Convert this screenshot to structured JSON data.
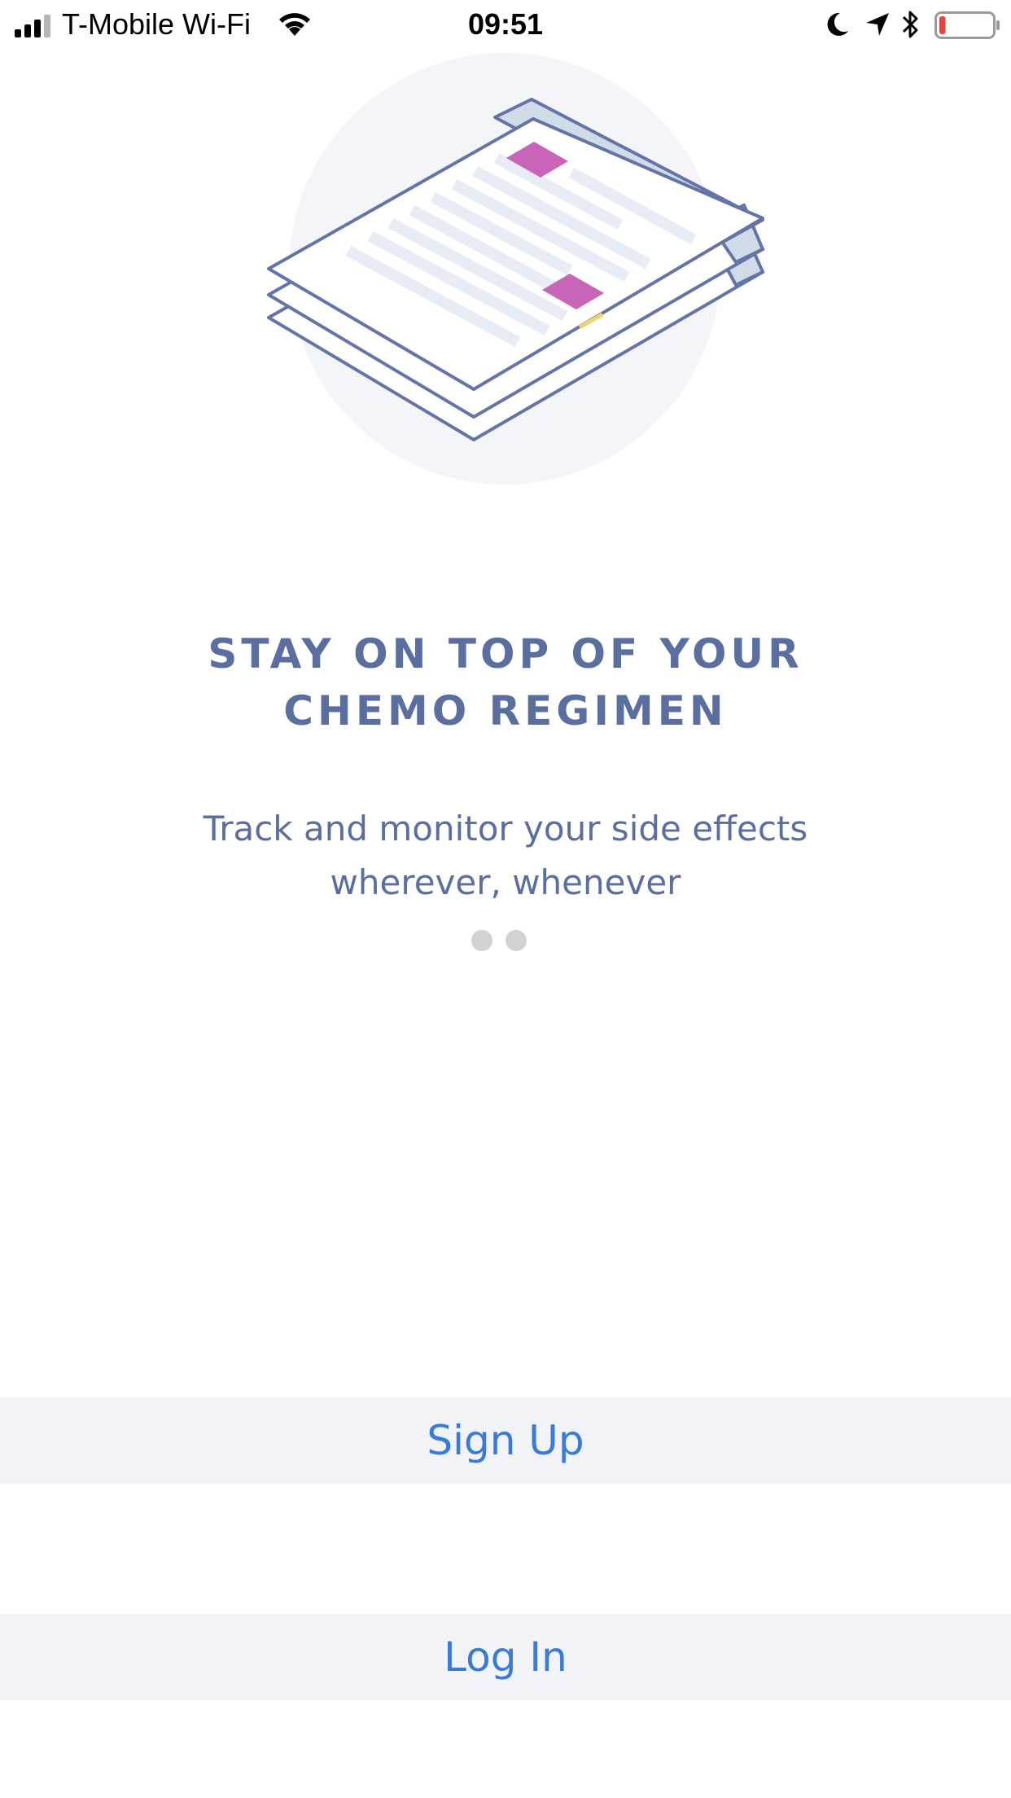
{
  "status_bar": {
    "carrier": "T-Mobile Wi-Fi",
    "time": "09:51",
    "icons": [
      "cellular-signal-icon",
      "wifi-icon",
      "moon-icon",
      "location-arrow-icon",
      "bluetooth-icon",
      "battery-icon"
    ],
    "battery_level_fraction": 0.12,
    "battery_color": "#e2473f"
  },
  "onboarding": {
    "illustration_icon": "stacked-documents-icon",
    "headline_line1": "STAY ON TOP OF YOUR",
    "headline_line2": "CHEMO REGIMEN",
    "subtitle_line1": "Track and monitor your side effects",
    "subtitle_line2": "wherever, whenever",
    "page_count": 2,
    "current_page": 1
  },
  "actions": {
    "signup_label": "Sign Up",
    "login_label": "Log In"
  },
  "colors": {
    "headline": "#5b6ea0",
    "button_text": "#3b7bd8",
    "button_background": "#f2f3f6",
    "accent_magenta": "#c965b8",
    "page_dot": "#d2d2d2"
  }
}
